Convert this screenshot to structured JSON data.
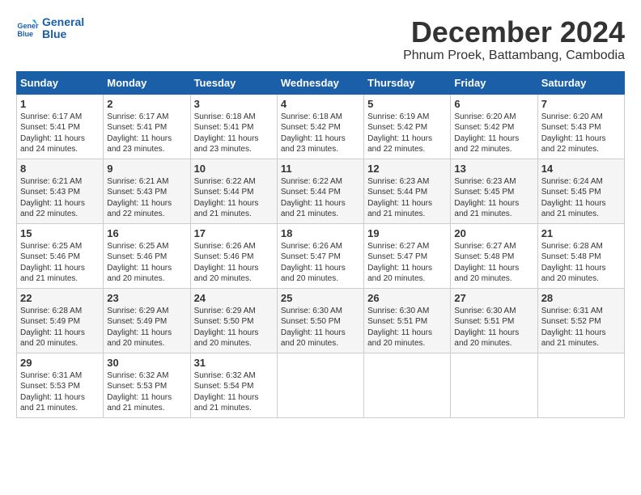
{
  "header": {
    "logo_line1": "General",
    "logo_line2": "Blue",
    "month": "December 2024",
    "location": "Phnum Proek, Battambang, Cambodia"
  },
  "days_of_week": [
    "Sunday",
    "Monday",
    "Tuesday",
    "Wednesday",
    "Thursday",
    "Friday",
    "Saturday"
  ],
  "weeks": [
    [
      {
        "day": 1,
        "rise": "6:17 AM",
        "set": "5:41 PM",
        "daylight": "11 hours and 24 minutes."
      },
      {
        "day": 2,
        "rise": "6:17 AM",
        "set": "5:41 PM",
        "daylight": "11 hours and 23 minutes."
      },
      {
        "day": 3,
        "rise": "6:18 AM",
        "set": "5:41 PM",
        "daylight": "11 hours and 23 minutes."
      },
      {
        "day": 4,
        "rise": "6:18 AM",
        "set": "5:42 PM",
        "daylight": "11 hours and 23 minutes."
      },
      {
        "day": 5,
        "rise": "6:19 AM",
        "set": "5:42 PM",
        "daylight": "11 hours and 22 minutes."
      },
      {
        "day": 6,
        "rise": "6:20 AM",
        "set": "5:42 PM",
        "daylight": "11 hours and 22 minutes."
      },
      {
        "day": 7,
        "rise": "6:20 AM",
        "set": "5:43 PM",
        "daylight": "11 hours and 22 minutes."
      }
    ],
    [
      {
        "day": 8,
        "rise": "6:21 AM",
        "set": "5:43 PM",
        "daylight": "11 hours and 22 minutes."
      },
      {
        "day": 9,
        "rise": "6:21 AM",
        "set": "5:43 PM",
        "daylight": "11 hours and 22 minutes."
      },
      {
        "day": 10,
        "rise": "6:22 AM",
        "set": "5:44 PM",
        "daylight": "11 hours and 21 minutes."
      },
      {
        "day": 11,
        "rise": "6:22 AM",
        "set": "5:44 PM",
        "daylight": "11 hours and 21 minutes."
      },
      {
        "day": 12,
        "rise": "6:23 AM",
        "set": "5:44 PM",
        "daylight": "11 hours and 21 minutes."
      },
      {
        "day": 13,
        "rise": "6:23 AM",
        "set": "5:45 PM",
        "daylight": "11 hours and 21 minutes."
      },
      {
        "day": 14,
        "rise": "6:24 AM",
        "set": "5:45 PM",
        "daylight": "11 hours and 21 minutes."
      }
    ],
    [
      {
        "day": 15,
        "rise": "6:25 AM",
        "set": "5:46 PM",
        "daylight": "11 hours and 21 minutes."
      },
      {
        "day": 16,
        "rise": "6:25 AM",
        "set": "5:46 PM",
        "daylight": "11 hours and 20 minutes."
      },
      {
        "day": 17,
        "rise": "6:26 AM",
        "set": "5:46 PM",
        "daylight": "11 hours and 20 minutes."
      },
      {
        "day": 18,
        "rise": "6:26 AM",
        "set": "5:47 PM",
        "daylight": "11 hours and 20 minutes."
      },
      {
        "day": 19,
        "rise": "6:27 AM",
        "set": "5:47 PM",
        "daylight": "11 hours and 20 minutes."
      },
      {
        "day": 20,
        "rise": "6:27 AM",
        "set": "5:48 PM",
        "daylight": "11 hours and 20 minutes."
      },
      {
        "day": 21,
        "rise": "6:28 AM",
        "set": "5:48 PM",
        "daylight": "11 hours and 20 minutes."
      }
    ],
    [
      {
        "day": 22,
        "rise": "6:28 AM",
        "set": "5:49 PM",
        "daylight": "11 hours and 20 minutes."
      },
      {
        "day": 23,
        "rise": "6:29 AM",
        "set": "5:49 PM",
        "daylight": "11 hours and 20 minutes."
      },
      {
        "day": 24,
        "rise": "6:29 AM",
        "set": "5:50 PM",
        "daylight": "11 hours and 20 minutes."
      },
      {
        "day": 25,
        "rise": "6:30 AM",
        "set": "5:50 PM",
        "daylight": "11 hours and 20 minutes."
      },
      {
        "day": 26,
        "rise": "6:30 AM",
        "set": "5:51 PM",
        "daylight": "11 hours and 20 minutes."
      },
      {
        "day": 27,
        "rise": "6:30 AM",
        "set": "5:51 PM",
        "daylight": "11 hours and 20 minutes."
      },
      {
        "day": 28,
        "rise": "6:31 AM",
        "set": "5:52 PM",
        "daylight": "11 hours and 21 minutes."
      }
    ],
    [
      {
        "day": 29,
        "rise": "6:31 AM",
        "set": "5:53 PM",
        "daylight": "11 hours and 21 minutes."
      },
      {
        "day": 30,
        "rise": "6:32 AM",
        "set": "5:53 PM",
        "daylight": "11 hours and 21 minutes."
      },
      {
        "day": 31,
        "rise": "6:32 AM",
        "set": "5:54 PM",
        "daylight": "11 hours and 21 minutes."
      },
      null,
      null,
      null,
      null
    ]
  ]
}
